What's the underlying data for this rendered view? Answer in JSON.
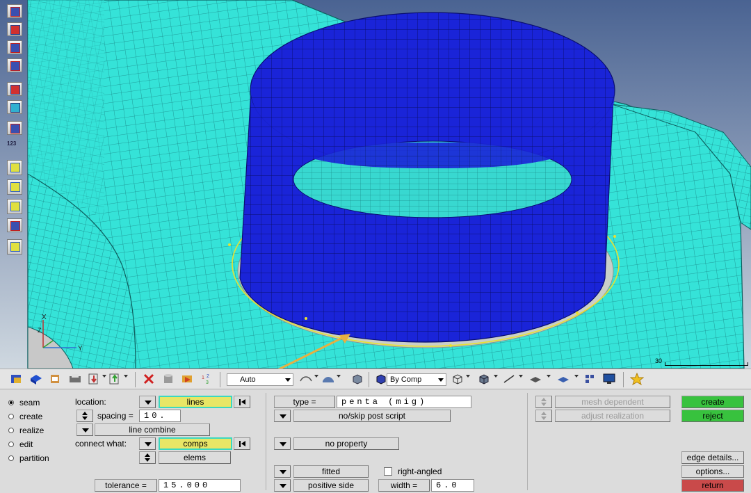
{
  "viewport": {
    "scale_label": "30",
    "axis": {
      "x": "X",
      "y": "Y",
      "z": "Z"
    },
    "colors": {
      "mesh_fill": "#35e3d8",
      "mesh_line": "#1a8c8c",
      "cylinder": "#1a24d8",
      "cylinder_line": "#0a0f70",
      "background_top": "#4a6392",
      "background_bottom": "#cfd8e0",
      "selection": "#e8e030"
    }
  },
  "left_toolbar": {
    "tools": [
      {
        "icon": "component-icon"
      },
      {
        "icon": "component-delete-icon"
      },
      {
        "icon": "display-icon"
      },
      {
        "icon": "mesh-icon"
      },
      {
        "icon": "table-icon"
      },
      {
        "icon": "element-check-icon"
      },
      {
        "icon": "find-icon"
      },
      {
        "icon": "numbering-icon",
        "label": "123"
      },
      {
        "icon": "measure-icon"
      },
      {
        "icon": "label-abc-icon"
      },
      {
        "icon": "label-abc-down-icon"
      },
      {
        "icon": "transform-icon"
      },
      {
        "icon": "shape-icon"
      }
    ]
  },
  "toolbar": {
    "auto_combo": "Auto",
    "by_comp_combo": "By Comp"
  },
  "panel": {
    "modes": [
      {
        "label": "seam",
        "selected": true
      },
      {
        "label": "create",
        "selected": false
      },
      {
        "label": "realize",
        "selected": false
      },
      {
        "label": "edit",
        "selected": false
      },
      {
        "label": "partition",
        "selected": false
      }
    ],
    "location_label": "location:",
    "location_value": "lines",
    "spacing_label": "spacing =",
    "spacing_value": "10.",
    "line_combine": "line combine",
    "connect_what_label": "connect what:",
    "connect_what_value": "comps",
    "elems_label": "elems",
    "tolerance_label": "tolerance =",
    "tolerance_value": "15.000",
    "type_label": "type =",
    "type_value": "penta (mig)",
    "post_script": "no/skip post script",
    "property": "no property",
    "fitted": "fitted",
    "positive_side": "positive side",
    "right_angled_label": "right-angled",
    "right_angled_checked": false,
    "width_label": "width =",
    "width_value": "6.0",
    "mesh_dependent": "mesh dependent",
    "adjust_realization": "adjust realization",
    "create": "create",
    "reject": "reject",
    "edge_details": "edge details...",
    "options": "options...",
    "return": "return"
  }
}
